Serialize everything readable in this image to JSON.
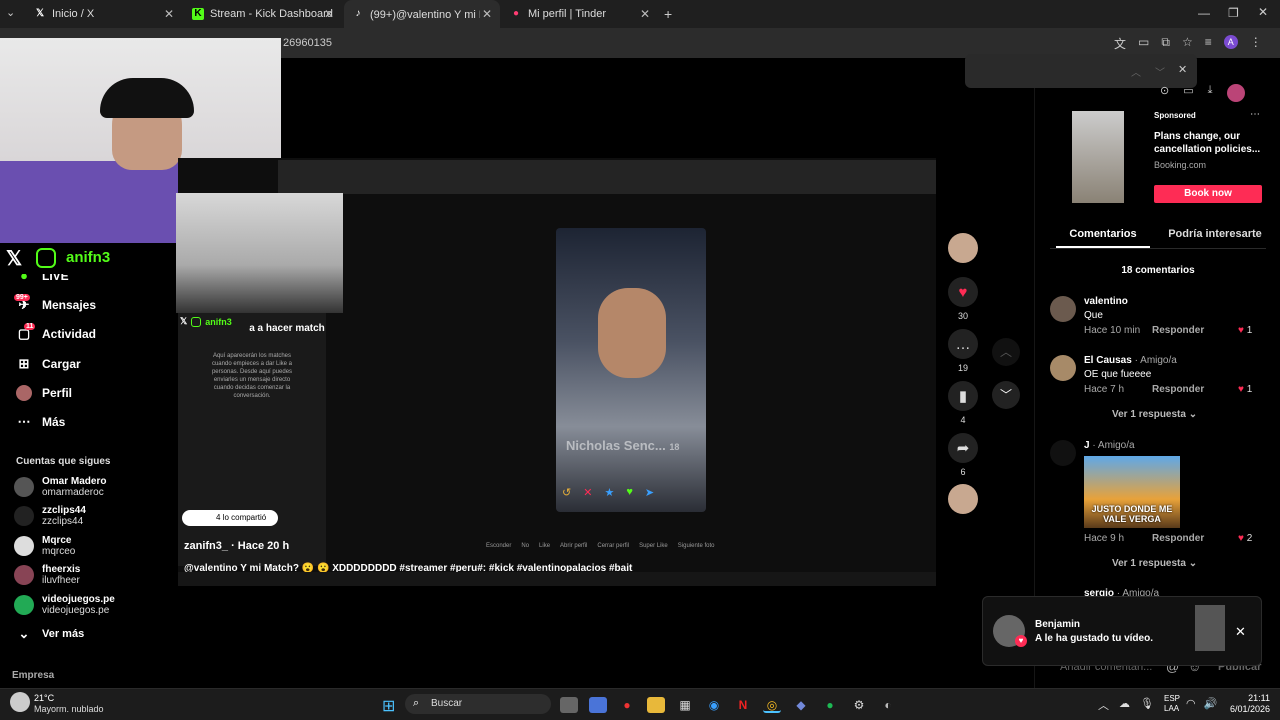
{
  "tabs": [
    {
      "label": "Inicio / X",
      "icon": "x-logo-icon"
    },
    {
      "label": "Stream - Kick Dashboard",
      "icon": "kick-logo-icon"
    },
    {
      "label": "(99+)@valentino Y mi Match? 😮",
      "icon": "tiktok-logo-icon"
    },
    {
      "label": "Mi perfil | Tinder",
      "icon": "tinder-logo-icon"
    }
  ],
  "url": "26960135",
  "overlay": {
    "handle": "anifn3",
    "small_handle": "anifn3"
  },
  "nav": [
    {
      "label": "LIVE",
      "icon": "live-icon"
    },
    {
      "label": "Mensajes",
      "icon": "messages-icon",
      "badge": "99+"
    },
    {
      "label": "Actividad",
      "icon": "activity-icon",
      "badge": "11"
    },
    {
      "label": "Cargar",
      "icon": "upload-icon"
    },
    {
      "label": "Perfil",
      "icon": "profile-icon"
    },
    {
      "label": "Más",
      "icon": "more-icon"
    }
  ],
  "following": {
    "title": "Cuentas que sigues",
    "accounts": [
      {
        "name": "Omar Madero",
        "handle": "omarmaderoc"
      },
      {
        "name": "zzclips44",
        "handle": "zzclips44"
      },
      {
        "name": "Mqrce",
        "handle": "mqrceo"
      },
      {
        "name": "fheerxis",
        "handle": "iluvfheer"
      },
      {
        "name": "videojuegos.pe",
        "handle": "videojuegos.pe"
      }
    ],
    "see_more": "Ver más"
  },
  "company": "Empresa",
  "inner_app": {
    "title_partial": "a a hacer match",
    "body": "Aquí aparecerán los matches cuando empieces a dar Like a personas. Desde aquí puedes enviarles un mensaje directo cuando decidas comenzar la conversación.",
    "profile_name": "Nicholas Senc...",
    "profile_age": "18",
    "bottom_bar": [
      "Esconder",
      "No",
      "Like",
      "Abrir perfil",
      "Cerrar perfil",
      "Super Like",
      "Siguiente foto"
    ]
  },
  "video_info": {
    "shared_label": "4 lo compartió",
    "author": "zanifn3_",
    "time": "Hace 20 h",
    "caption": "@valentino Y mi Match? 😮 😮 XDDDDDDDD #streamer #peru#: #kick #valentinopalacios #bait"
  },
  "actions": {
    "likes": "30",
    "comments": "19",
    "saves": "4",
    "shares": "6"
  },
  "sponsored": {
    "label": "Sponsored",
    "headline": "Plans change, our cancellation policies...",
    "site": "Booking.com",
    "cta": "Book now"
  },
  "panel_tabs": {
    "comments": "Comentarios",
    "related": "Podría interesarte"
  },
  "comment_count": "18 comentarios",
  "comments": [
    {
      "name": "valentino",
      "tag": "",
      "text": "Que",
      "time": "Hace 10 min",
      "reply": "Responder",
      "likes": "1"
    },
    {
      "name": "El Causas",
      "tag": " · Amigo/a",
      "text": "OE que fueeee",
      "time": "Hace 7 h",
      "reply": "Responder",
      "likes": "1",
      "more": "Ver 1 respuesta"
    },
    {
      "name": "J",
      "tag": " · Amigo/a",
      "text": "",
      "image_caption": "JUSTO DONDE ME VALE VERGA",
      "time": "Hace 9 h",
      "reply": "Responder",
      "likes": "2",
      "more": "Ver 1 respuesta"
    },
    {
      "name": "sergio",
      "tag": " · Amigo/a"
    }
  ],
  "comment_input_placeholder": "Añadir comentari...",
  "post_label": "Publicar",
  "notification": {
    "name": "Benjamin",
    "message": "A le ha gustado tu vídeo."
  },
  "taskbar": {
    "weather_temp": "21°C",
    "weather_desc": "Mayorm. nublado",
    "search": "Buscar",
    "lang1": "ESP",
    "lang2": "LAA",
    "time": "21:11",
    "date": "6/01/2026"
  },
  "colors": {
    "accent": "#fe2c55",
    "kick_green": "#53fc18",
    "bg": "#000000"
  }
}
